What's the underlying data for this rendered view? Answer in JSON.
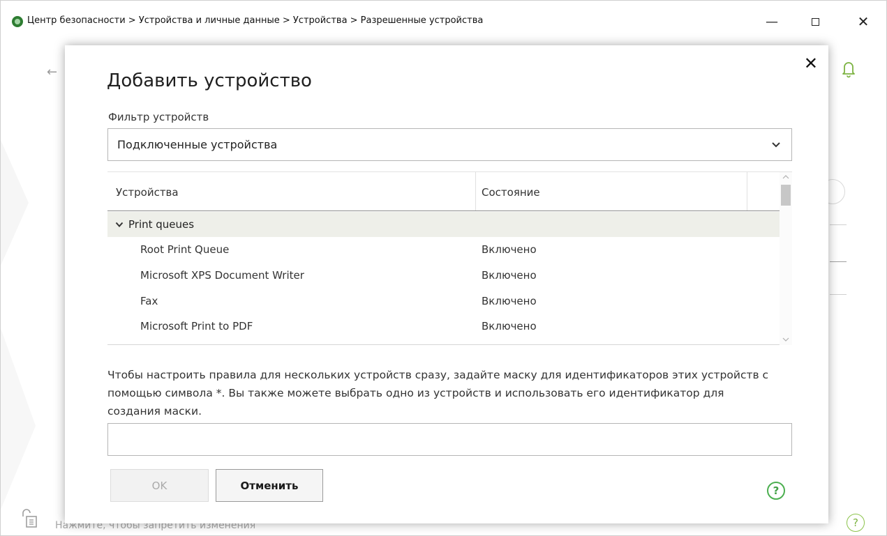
{
  "window": {
    "breadcrumb": "Центр безопасности > Устройства и личные данные > Устройства > Разрешенные устройства",
    "minimize_glyph": "—",
    "close_glyph": "✕"
  },
  "background": {
    "back_glyph": "←",
    "lock_hint": "Нажмите, чтобы запретить изменения",
    "help_glyph": "?",
    "accent_color": "#7cb342"
  },
  "dialog": {
    "close_glyph": "✕",
    "title": "Добавить устройство",
    "filter_label": "Фильтр устройств",
    "filter_value": "Подключенные устройства",
    "table": {
      "col_devices": "Устройства",
      "col_state": "Состояние",
      "group": "Print queues",
      "rows": [
        {
          "device": "Root Print Queue",
          "state": "Включено"
        },
        {
          "device": "Microsoft XPS Document Writer",
          "state": "Включено"
        },
        {
          "device": "Fax",
          "state": "Включено"
        },
        {
          "device": "Microsoft Print to PDF",
          "state": "Включено"
        }
      ]
    },
    "hint": "Чтобы настроить правила для нескольких устройств сразу, задайте маску для идентификаторов этих устройств с помощью символа *. Вы также можете выбрать одно из устройств и использовать его идентификатор для создания маски.",
    "mask_value": "",
    "ok_label": "OK",
    "cancel_label": "Отменить",
    "help_glyph": "?"
  }
}
